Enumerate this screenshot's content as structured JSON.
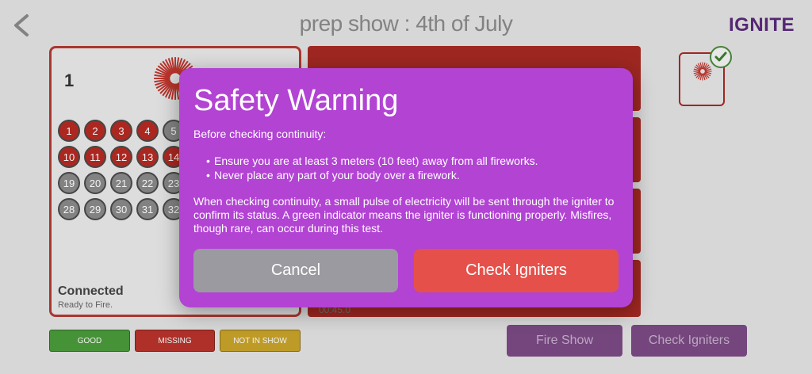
{
  "header": {
    "title": "prep show :  4th of July",
    "logo": "IGNITE"
  },
  "module": {
    "number": "1",
    "status": "Connected",
    "status_sub": "Ready to Fire.",
    "cues": [
      {
        "label": "1",
        "state": "red"
      },
      {
        "label": "2",
        "state": "red"
      },
      {
        "label": "3",
        "state": "red"
      },
      {
        "label": "4",
        "state": "red"
      },
      {
        "label": "5",
        "state": "grey"
      },
      {
        "label": "10",
        "state": "red"
      },
      {
        "label": "11",
        "state": "red"
      },
      {
        "label": "12",
        "state": "red"
      },
      {
        "label": "13",
        "state": "red"
      },
      {
        "label": "14",
        "state": "red"
      },
      {
        "label": "19",
        "state": "grey"
      },
      {
        "label": "20",
        "state": "grey"
      },
      {
        "label": "21",
        "state": "grey"
      },
      {
        "label": "22",
        "state": "grey"
      },
      {
        "label": "23",
        "state": "grey"
      },
      {
        "label": "28",
        "state": "grey"
      },
      {
        "label": "29",
        "state": "grey"
      },
      {
        "label": "30",
        "state": "grey"
      },
      {
        "label": "31",
        "state": "grey"
      },
      {
        "label": "32",
        "state": "grey"
      }
    ]
  },
  "timeline": {
    "time": "00:45.0"
  },
  "legend": {
    "good": "GOOD",
    "missing": "MISSING",
    "not_in_show": "NOT IN SHOW"
  },
  "buttons": {
    "fire_show": "Fire Show",
    "check_igniters": "Check Igniters"
  },
  "modal": {
    "title": "Safety Warning",
    "intro": "Before checking continuity:",
    "bullets": [
      "Ensure you are at least 3 meters (10 feet) away from all fireworks.",
      "Never place any part of your body over a firework."
    ],
    "paragraph": "When checking continuity, a small pulse of electricity will be sent through the igniter to confirm its status. A green indicator means the igniter is functioning properly. Misfires, though rare, can occur during this test.",
    "cancel": "Cancel",
    "confirm": "Check Igniters"
  },
  "colors": {
    "modal_bg": "#b243d3",
    "confirm_bg": "#e6504a",
    "cancel_bg": "#9b9aa0",
    "good": "#4a9a3a",
    "missing": "#b8332c",
    "not_in_show": "#c9a42a"
  },
  "icons": {
    "back": "chevron-left-icon",
    "firework": "firework-burst-icon",
    "check": "checkmark-icon"
  }
}
